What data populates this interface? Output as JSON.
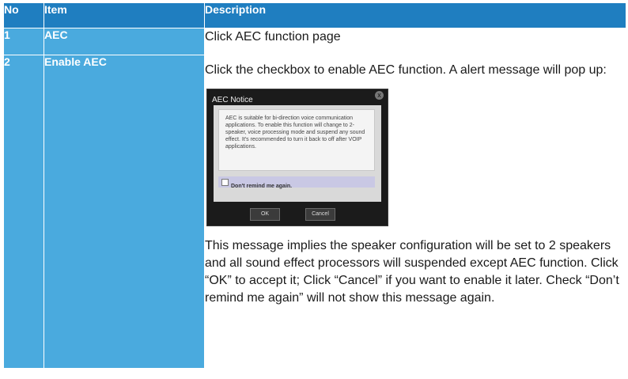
{
  "table": {
    "headers": {
      "no": "No",
      "item": "Item",
      "description": "Description"
    },
    "rows": [
      {
        "no": "1",
        "item": "AEC",
        "description": "Click AEC function page"
      },
      {
        "no": "2",
        "item": "Enable AEC",
        "description_intro": "Click the checkbox to enable AEC function. A alert message will pop up:",
        "description_outro": "This message implies the speaker configuration will be set to 2 speakers and all sound effect processors will suspended except AEC function. Click “OK” to accept it; Click “Cancel” if you want to enable it later. Check “Don’t remind me again” will not show this message again."
      }
    ]
  },
  "dialog": {
    "title": "AEC Notice",
    "close_glyph": "x",
    "message": "AEC is suitable for bi-direction voice communication applications. To enable this function will change to 2-speaker, voice processing mode and suspend any sound effect. It's recommended to turn it back to off after VOIP applications.",
    "checkbox_label": "Don't remind me again.",
    "ok_label": "OK",
    "cancel_label": "Cancel"
  },
  "colors": {
    "header_bg": "#1f7ec0",
    "cell_bg": "#4aaade",
    "text_white": "#ffffff"
  }
}
